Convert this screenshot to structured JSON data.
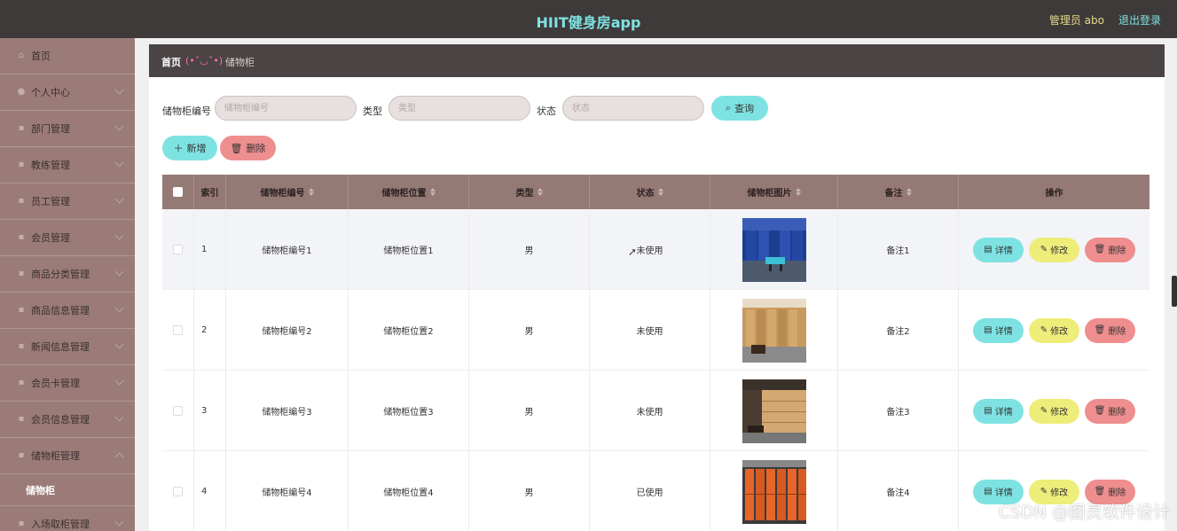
{
  "header": {
    "title": "HIIT健身房app",
    "admin_label": "管理员 abo",
    "logout_label": "退出登录"
  },
  "sidebar": {
    "items": [
      {
        "label": "首页",
        "icon": "home-icon"
      },
      {
        "label": "个人中心",
        "icon": "user-icon"
      },
      {
        "label": "部门管理",
        "icon": "menu-icon"
      },
      {
        "label": "教练管理",
        "icon": "menu-icon"
      },
      {
        "label": "员工管理",
        "icon": "menu-icon"
      },
      {
        "label": "会员管理",
        "icon": "menu-icon"
      },
      {
        "label": "商品分类管理",
        "icon": "menu-icon"
      },
      {
        "label": "商品信息管理",
        "icon": "menu-icon"
      },
      {
        "label": "新闻信息管理",
        "icon": "menu-icon"
      },
      {
        "label": "会员卡管理",
        "icon": "menu-icon"
      },
      {
        "label": "会员信息管理",
        "icon": "menu-icon"
      },
      {
        "label": "储物柜管理",
        "icon": "menu-icon"
      },
      {
        "label": "入场取柜管理",
        "icon": "menu-icon"
      }
    ],
    "sub_item": "储物柜"
  },
  "breadcrumb": {
    "home": "首页",
    "face": "(•ˇ◡ˇ•)",
    "current": "储物柜"
  },
  "search": {
    "fields": [
      {
        "label": "储物柜编号",
        "placeholder": "储物柜编号"
      },
      {
        "label": "类型",
        "placeholder": "类型"
      },
      {
        "label": "状态",
        "placeholder": "状态"
      }
    ],
    "query_label": "查询"
  },
  "toolbar": {
    "add_label": "新增",
    "delete_label": "删除"
  },
  "table": {
    "headers": [
      "索引",
      "储物柜编号",
      "储物柜位置",
      "类型",
      "状态",
      "储物柜图片",
      "备注",
      "操作"
    ],
    "rows": [
      {
        "index": "1",
        "code": "储物柜编号1",
        "location": "储物柜位置1",
        "type": "男",
        "status": "未使用",
        "note": "备注1"
      },
      {
        "index": "2",
        "code": "储物柜编号2",
        "location": "储物柜位置2",
        "type": "男",
        "status": "未使用",
        "note": "备注2"
      },
      {
        "index": "3",
        "code": "储物柜编号3",
        "location": "储物柜位置3",
        "type": "男",
        "status": "未使用",
        "note": "备注3"
      },
      {
        "index": "4",
        "code": "储物柜编号4",
        "location": "储物柜位置4",
        "type": "男",
        "status": "已使用",
        "note": "备注4"
      }
    ],
    "actions": {
      "detail": "详情",
      "edit": "修改",
      "delete": "删除"
    }
  },
  "watermark": "CSDN @图灵软件设计",
  "colors": {
    "topbar": "#3e3a39",
    "accent_cyan": "#7fe2e2",
    "sidebar": "#9a7b78",
    "table_header": "#957975",
    "danger": "#ef8e8e",
    "warning": "#eeed7a"
  }
}
